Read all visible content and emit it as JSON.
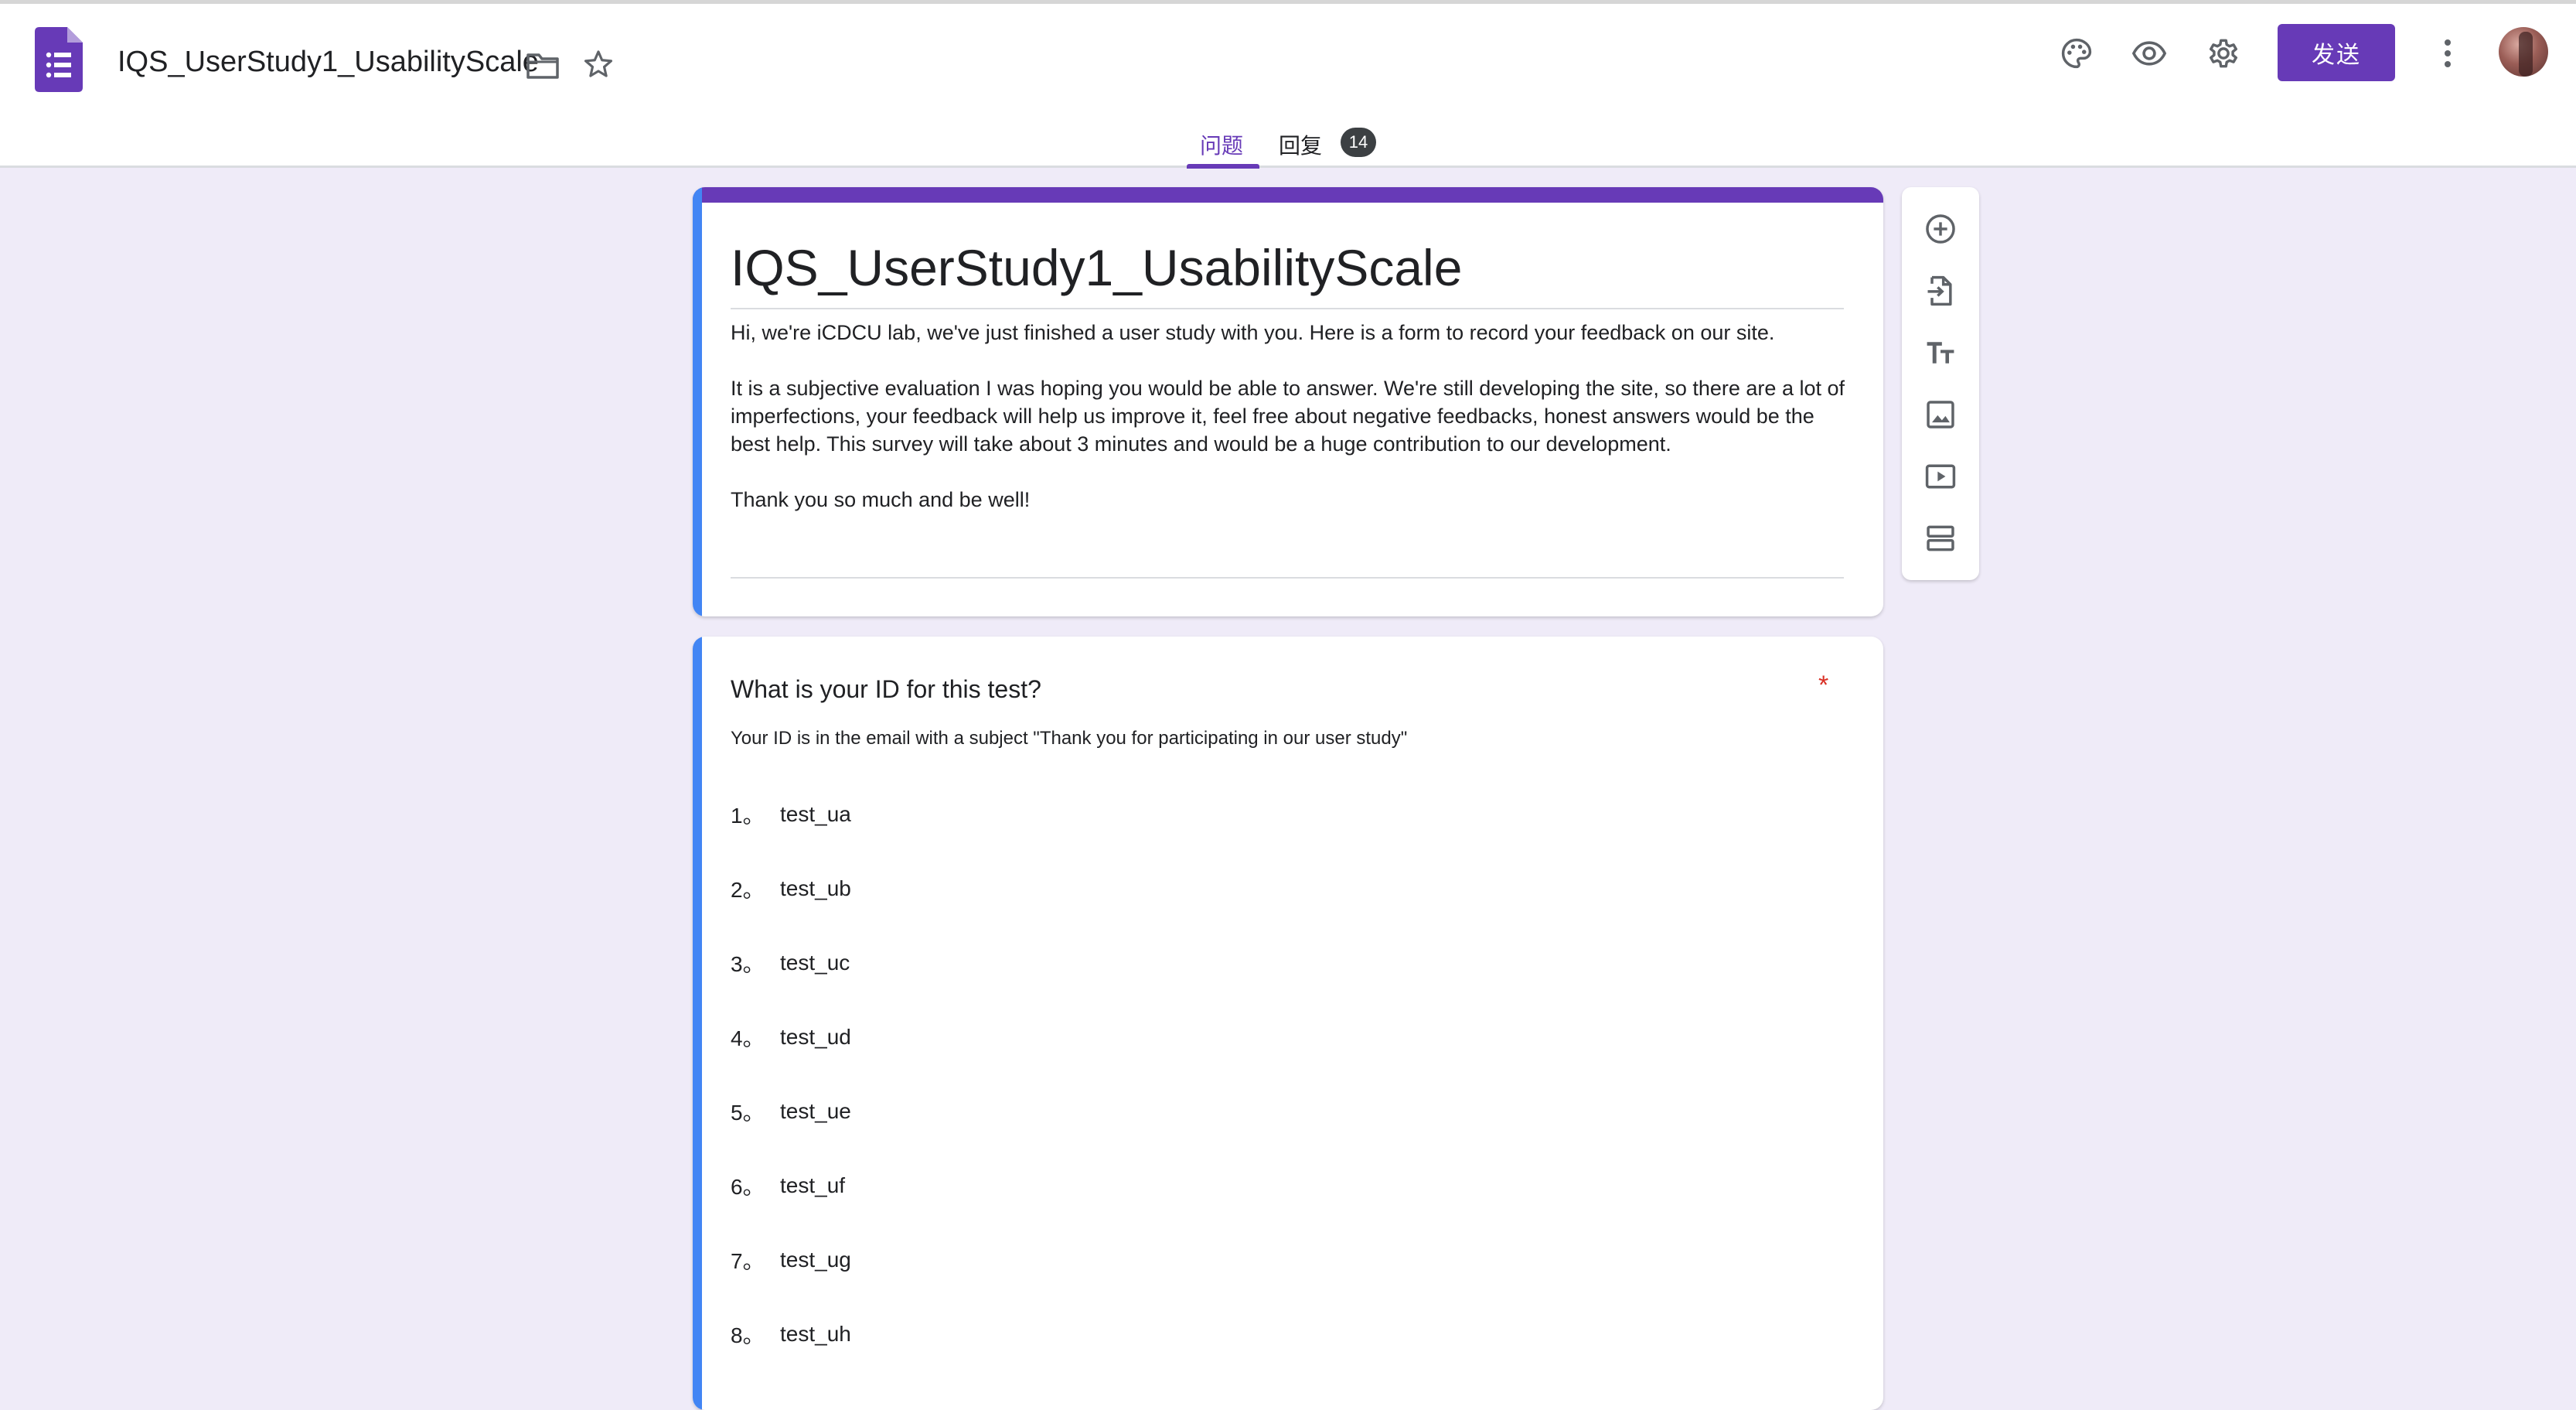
{
  "header": {
    "doc_title": "IQS_UserStudy1_UsabilityScale",
    "send_label": "发送"
  },
  "tabs": {
    "questions": "问题",
    "responses": "回复",
    "responses_count": "14"
  },
  "form": {
    "title": "IQS_UserStudy1_UsabilityScale",
    "description": [
      "Hi, we're iCDCU lab, we've just finished a user study with you. Here is a form to record your feedback on our site.",
      "It is a subjective evaluation I was hoping you would be able to answer. We're still developing the site, so there are a lot of imperfections, your feedback will help us improve it, feel free about negative feedbacks, honest answers would be the best help. This survey will take about 3 minutes and would be a huge contribution to our development.",
      "Thank you so much and be well!"
    ]
  },
  "question": {
    "title": "What is your ID for this test?",
    "required_mark": "*",
    "description": "Your ID is in the email with a subject \"Thank you for participating in our user study\"",
    "options": [
      {
        "num": "1。",
        "label": "test_ua"
      },
      {
        "num": "2。",
        "label": "test_ub"
      },
      {
        "num": "3。",
        "label": "test_uc"
      },
      {
        "num": "4。",
        "label": "test_ud"
      },
      {
        "num": "5。",
        "label": "test_ue"
      },
      {
        "num": "6。",
        "label": "test_uf"
      },
      {
        "num": "7。",
        "label": "test_ug"
      },
      {
        "num": "8。",
        "label": "test_uh"
      }
    ]
  },
  "icons": {
    "app": "google-forms-icon",
    "folder": "folder-icon",
    "star": "star-icon",
    "palette": "palette-icon",
    "preview": "eye-icon",
    "settings": "gear-icon",
    "more": "more-vert-icon",
    "toolbar": [
      "add-question-icon",
      "import-questions-icon",
      "title-text-icon",
      "image-icon",
      "video-icon",
      "section-icon"
    ]
  },
  "colors": {
    "accent": "#673ab7",
    "background": "#efebf8",
    "active_card_bar": "#4285f4",
    "required": "#d93025"
  }
}
